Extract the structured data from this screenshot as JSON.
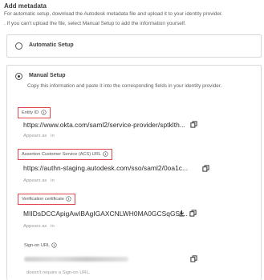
{
  "header": {
    "title": "Add metadata",
    "intro_line1": "For automatic setup, download the Autodesk metadata file and upload it to your identity provider.",
    "intro_line2": ". If you can't upload the file, select Manual Setup to add the information yourself."
  },
  "options": {
    "automatic_label": "Automatic Setup",
    "manual_label": "Manual Setup",
    "manual_description": "Copy this information and paste it into the corresponding fields in your identity provider."
  },
  "fields": {
    "entity_id": {
      "label": "Entity ID",
      "value": "https://www.okta.com/saml2/service-provider/sptklth...",
      "appears_as": "Appears as",
      "appears_in": "in"
    },
    "acs_url": {
      "label": "Assertion Customer Service (ACS) URL",
      "value": "https://authn-staging.autodesk.com/sso/saml2/0oa1c...",
      "appears_as": "Appears as",
      "appears_in": "in"
    },
    "verification_certificate": {
      "label": "Verification certificate",
      "value": "MIIDsDCCApigAwIBAgIGAXCNLWH0MA0GCSqGSI...",
      "appears_as": "Appears as",
      "appears_in": "in"
    },
    "sign_on_url": {
      "label": "Sign-on URL",
      "note": "doesn't require a Sign-on URL."
    }
  },
  "selected_option": "Manual Setup",
  "colors": {
    "highlight_box": "#e0474c",
    "text": "#3c3c3c",
    "muted": "#9a9a9a"
  },
  "icons": [
    "info-icon",
    "copy-icon",
    "download-icon"
  ]
}
